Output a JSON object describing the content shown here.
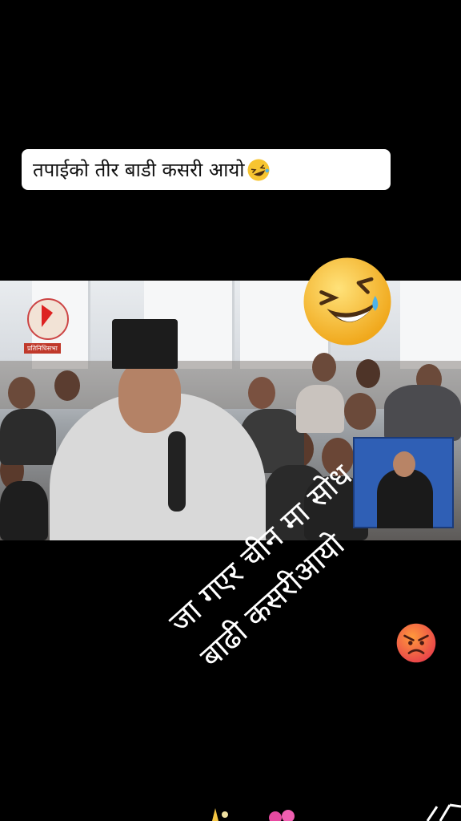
{
  "caption": {
    "text": "तपाईको तीर बाडी कसरी आयो"
  },
  "video": {
    "logo_label": "प्रतिनिधिसभा"
  },
  "overlay": {
    "line1": "जा गएर चीन मा सोध",
    "line2": "बाढी कसरीआयो"
  },
  "colors": {
    "background": "#000000",
    "caption_bg": "#ffffff",
    "sign_box": "#2f5fb5"
  }
}
